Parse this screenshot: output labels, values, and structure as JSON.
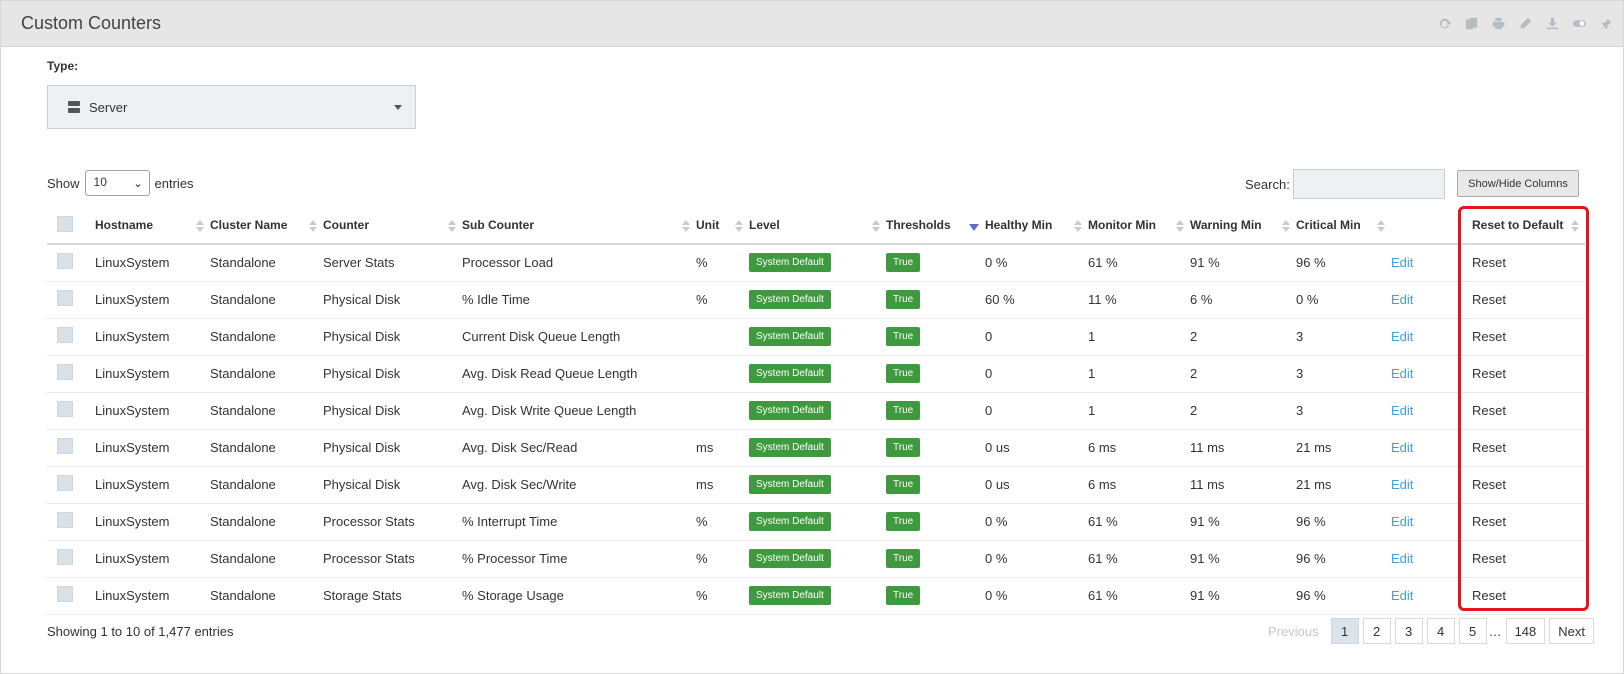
{
  "panel": {
    "title": "Custom Counters",
    "toolbar_icons": [
      "refresh-icon",
      "copy-icon",
      "print-icon",
      "edit-icon",
      "download-icon",
      "toggle-icon",
      "pin-icon"
    ]
  },
  "type_filter": {
    "label": "Type:",
    "selected": "Server",
    "icon": "server-icon"
  },
  "length_menu": {
    "show_label": "Show",
    "value": "10",
    "entries_label": "entries"
  },
  "search": {
    "label": "Search:",
    "value": ""
  },
  "columns_button": "Show/Hide Columns",
  "table": {
    "headers": [
      "Hostname",
      "Cluster Name",
      "Counter",
      "Sub Counter",
      "Unit",
      "Level",
      "Thresholds",
      "Healthy Min",
      "Monitor Min",
      "Warning Min",
      "Critical Min",
      "",
      "Reset to Default"
    ],
    "sorted_column": "Thresholds",
    "rows": [
      [
        "LinuxSystem",
        "Standalone",
        "Server Stats",
        "Processor Load",
        "%",
        "System Default",
        "True",
        "0 %",
        "61 %",
        "91 %",
        "96 %",
        "Edit",
        "Reset"
      ],
      [
        "LinuxSystem",
        "Standalone",
        "Physical Disk",
        "% Idle Time",
        "%",
        "System Default",
        "True",
        "60 %",
        "11 %",
        "6 %",
        "0 %",
        "Edit",
        "Reset"
      ],
      [
        "LinuxSystem",
        "Standalone",
        "Physical Disk",
        "Current Disk Queue Length",
        "",
        "System Default",
        "True",
        "0",
        "1",
        "2",
        "3",
        "Edit",
        "Reset"
      ],
      [
        "LinuxSystem",
        "Standalone",
        "Physical Disk",
        "Avg. Disk Read Queue Length",
        "",
        "System Default",
        "True",
        "0",
        "1",
        "2",
        "3",
        "Edit",
        "Reset"
      ],
      [
        "LinuxSystem",
        "Standalone",
        "Physical Disk",
        "Avg. Disk Write Queue Length",
        "",
        "System Default",
        "True",
        "0",
        "1",
        "2",
        "3",
        "Edit",
        "Reset"
      ],
      [
        "LinuxSystem",
        "Standalone",
        "Physical Disk",
        "Avg. Disk Sec/Read",
        "ms",
        "System Default",
        "True",
        "0 us",
        "6 ms",
        "11 ms",
        "21 ms",
        "Edit",
        "Reset"
      ],
      [
        "LinuxSystem",
        "Standalone",
        "Physical Disk",
        "Avg. Disk Sec/Write",
        "ms",
        "System Default",
        "True",
        "0 us",
        "6 ms",
        "11 ms",
        "21 ms",
        "Edit",
        "Reset"
      ],
      [
        "LinuxSystem",
        "Standalone",
        "Processor Stats",
        "% Interrupt Time",
        "%",
        "System Default",
        "True",
        "0 %",
        "61 %",
        "91 %",
        "96 %",
        "Edit",
        "Reset"
      ],
      [
        "LinuxSystem",
        "Standalone",
        "Processor Stats",
        "% Processor Time",
        "%",
        "System Default",
        "True",
        "0 %",
        "61 %",
        "91 %",
        "96 %",
        "Edit",
        "Reset"
      ],
      [
        "LinuxSystem",
        "Standalone",
        "Storage Stats",
        "% Storage Usage",
        "%",
        "System Default",
        "True",
        "0 %",
        "61 %",
        "91 %",
        "96 %",
        "Edit",
        "Reset"
      ]
    ]
  },
  "footer": {
    "info": "Showing 1 to 10 of 1,477 entries",
    "pagination": {
      "previous": "Previous",
      "pages": [
        "1",
        "2",
        "3",
        "4",
        "5"
      ],
      "ellipsis": "…",
      "last": "148",
      "next": "Next",
      "active": "1"
    }
  },
  "colors": {
    "badge_green": "#3f9a3f",
    "link_blue": "#3ea2d8",
    "highlight_red": "#e3151a",
    "header_bg": "#e6e6e6"
  }
}
